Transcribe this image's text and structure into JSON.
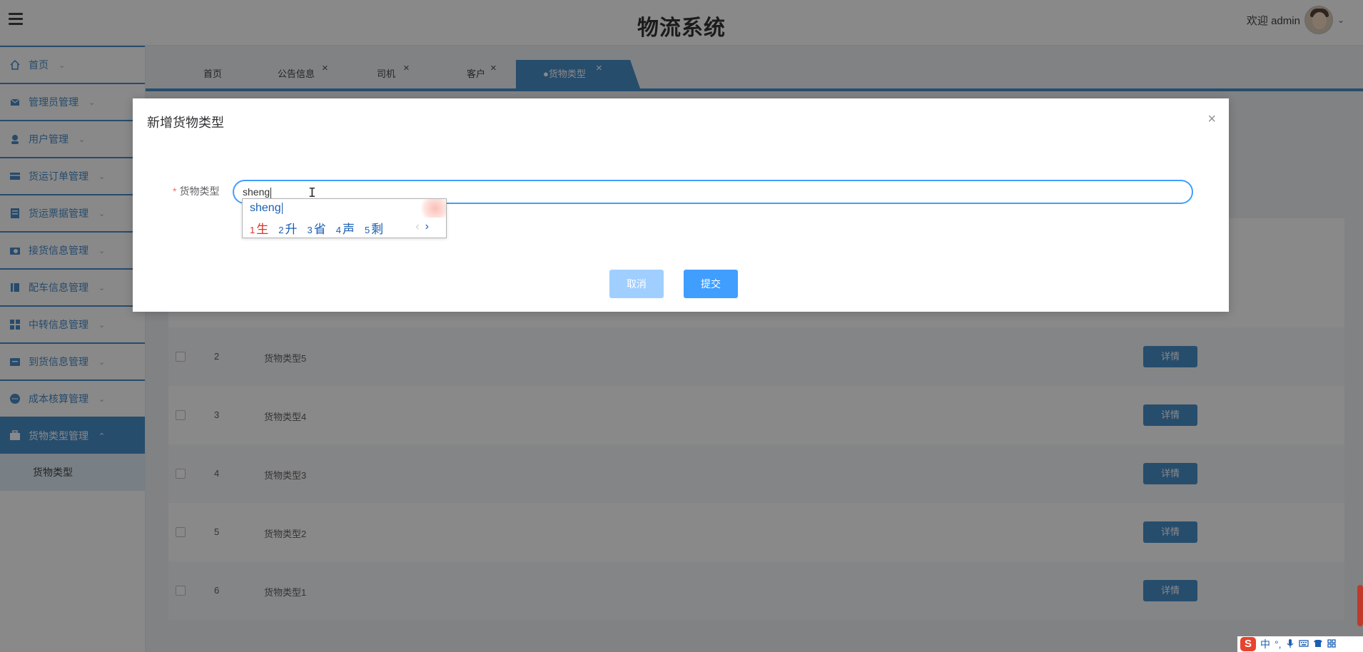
{
  "app": {
    "title": "物流系统"
  },
  "header": {
    "welcome": "欢迎 admin",
    "chevron": "⌄"
  },
  "sidebar": {
    "items": [
      {
        "label": "首页",
        "icon": "home-icon"
      },
      {
        "label": "管理员管理",
        "icon": "mail-icon"
      },
      {
        "label": "用户管理",
        "icon": "user-icon"
      },
      {
        "label": "货运订单管理",
        "icon": "order-icon"
      },
      {
        "label": "货运票据管理",
        "icon": "receipt-icon"
      },
      {
        "label": "接货信息管理",
        "icon": "camera-icon"
      },
      {
        "label": "配车信息管理",
        "icon": "book-icon"
      },
      {
        "label": "中转信息管理",
        "icon": "grid-icon"
      },
      {
        "label": "到货信息管理",
        "icon": "wallet-icon"
      },
      {
        "label": "成本核算管理",
        "icon": "chat-icon"
      },
      {
        "label": "货物类型管理",
        "icon": "briefcase-icon"
      }
    ],
    "sub_item": "货物类型"
  },
  "tabs": [
    {
      "label": "首页",
      "closable": false
    },
    {
      "label": "公告信息",
      "closable": true
    },
    {
      "label": "司机",
      "closable": true
    },
    {
      "label": "客户",
      "closable": true
    },
    {
      "label": "●货物类型",
      "closable": true
    }
  ],
  "table": {
    "rows": [
      {
        "index": "2",
        "name": "货物类型5",
        "action": "详情"
      },
      {
        "index": "3",
        "name": "货物类型4",
        "action": "详情"
      },
      {
        "index": "4",
        "name": "货物类型3",
        "action": "详情"
      },
      {
        "index": "5",
        "name": "货物类型2",
        "action": "详情"
      },
      {
        "index": "6",
        "name": "货物类型1",
        "action": "详情"
      }
    ]
  },
  "modal": {
    "title": "新增货物类型",
    "close": "×",
    "field_label": "货物类型",
    "required_mark": "*",
    "input_value": "sheng",
    "cancel_label": "取消",
    "submit_label": "提交"
  },
  "ime": {
    "pinyin": "sheng",
    "candidates": [
      {
        "n": "1",
        "text": "生"
      },
      {
        "n": "2",
        "text": "升"
      },
      {
        "n": "3",
        "text": "省"
      },
      {
        "n": "4",
        "text": "声"
      },
      {
        "n": "5",
        "text": "剩"
      }
    ],
    "prev": "‹",
    "next": "›"
  },
  "tray": {
    "logo": "S",
    "mode": "中",
    "punct": "°,"
  },
  "colors": {
    "primary": "#409eff",
    "sidebar_accent": "#3b86c7",
    "overlay": "rgba(20,20,20,0.5)"
  }
}
